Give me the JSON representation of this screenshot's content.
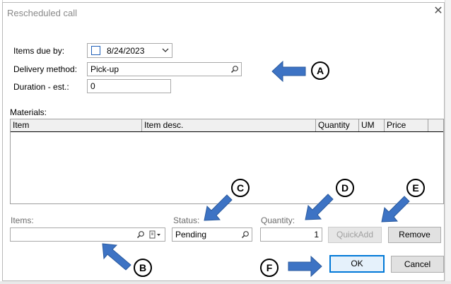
{
  "dialog": {
    "title": "Rescheduled call"
  },
  "form": {
    "items_due_by_label": "Items due by:",
    "items_due_by_value": "8/24/2023",
    "delivery_method_label": "Delivery method:",
    "delivery_method_value": "Pick-up",
    "duration_label": "Duration - est.:",
    "duration_value": "0"
  },
  "materials": {
    "label": "Materials:",
    "columns": [
      "Item",
      "Item desc.",
      "Quantity",
      "UM",
      "Price"
    ]
  },
  "entry": {
    "items_label": "Items:",
    "items_value": "",
    "status_label": "Status:",
    "status_value": "Pending",
    "quantity_label": "Quantity:",
    "quantity_value": "1"
  },
  "buttons": {
    "quickadd": "QuickAdd",
    "remove": "Remove",
    "ok": "OK",
    "cancel": "Cancel"
  },
  "callouts": [
    "A",
    "B",
    "C",
    "D",
    "E",
    "F"
  ],
  "colors": {
    "arrow": "#3d73c4",
    "ok_border": "#0078d7"
  }
}
